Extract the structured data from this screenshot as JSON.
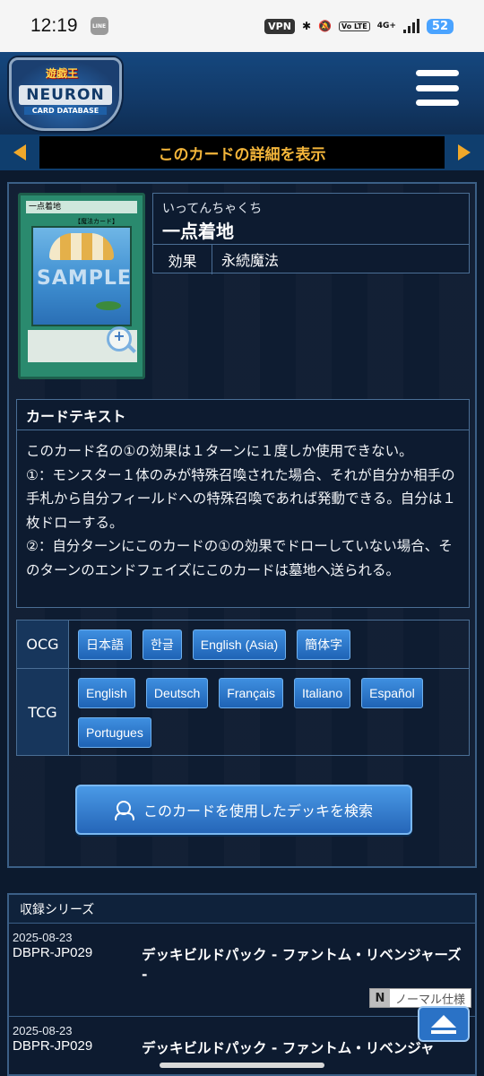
{
  "status_bar": {
    "time": "12:19",
    "app_badge": "LINE",
    "vpn": "VPN",
    "volte": "Vo LTE",
    "network": "4G+",
    "battery": "52"
  },
  "header": {
    "logo_top": "遊戯王",
    "logo_main": "NEURON",
    "logo_sub": "CARD DATABASE"
  },
  "detail_bar": {
    "title": "このカードの詳細を表示"
  },
  "card": {
    "image_name_strip": "一点着地",
    "image_type_strip": "【魔法カード】",
    "image_watermark": "SAMPLE",
    "ruby": "いってんちゃくち",
    "name": "一点着地",
    "attr_key": "効果",
    "attr_value": "永続魔法"
  },
  "card_text": {
    "heading": "カードテキスト",
    "lines": [
      "このカード名の①の効果は１ターンに１度しか使用できない。",
      "①：モンスター１体のみが特殊召喚された場合、それが自分か相手の手札から自分フィールドへの特殊召喚であれば発動できる。自分は１枚ドローする。",
      "②：自分ターンにこのカードの①の効果でドローしていない場合、そのターンのエンドフェイズにこのカードは墓地へ送られる。"
    ]
  },
  "languages": {
    "ocg_label": "OCG",
    "ocg": [
      "日本語",
      "한글",
      "English (Asia)",
      "簡体字"
    ],
    "tcg_label": "TCG",
    "tcg": [
      "English",
      "Deutsch",
      "Français",
      "Italiano",
      "Español",
      "Portugues"
    ]
  },
  "deck_search": {
    "label": "このカードを使用したデッキを検索"
  },
  "series": {
    "heading": "収録シリーズ",
    "rows": [
      {
        "date": "2025-08-23",
        "code": "DBPR-JP029",
        "name": "デッキビルドパック - ファントム・リベンジャーズ -",
        "rarity_mark": "N",
        "rarity_name": "ノーマル仕様"
      },
      {
        "date": "2025-08-23",
        "code": "DBPR-JP029",
        "name": "デッキビルドパック - ファントム・リベンジャ"
      }
    ]
  }
}
